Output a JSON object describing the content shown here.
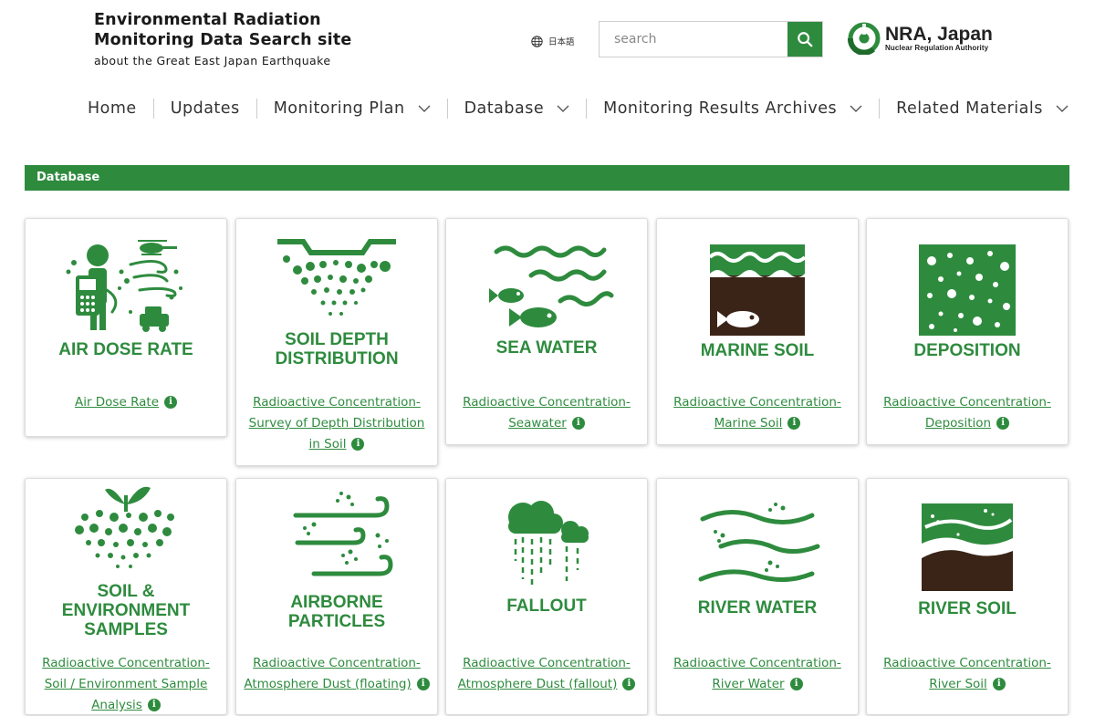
{
  "header": {
    "title_line1": "Environmental Radiation",
    "title_line2": "Monitoring Data Search site",
    "title_line3": "about the Great East Japan Earthquake",
    "language_label": "日本語",
    "search_placeholder": "search",
    "logo_name": "NRA, Japan",
    "logo_sub": "Nuclear Regulation Authority"
  },
  "nav": {
    "items": [
      {
        "label": "Home"
      },
      {
        "label": "Updates"
      },
      {
        "label": "Monitoring Plan"
      },
      {
        "label": "Database"
      },
      {
        "label": "Monitoring Results Archives"
      },
      {
        "label": "Related Materials"
      }
    ]
  },
  "section": {
    "title": "Database"
  },
  "cards": [
    {
      "title_lines": [
        "AIR DOSE RATE"
      ],
      "link": "Air Dose Rate",
      "icon": "air-dose-rate-icon"
    },
    {
      "title_lines": [
        "SOIL DEPTH",
        "DISTRIBUTION"
      ],
      "link": "Radioactive Concentration-Survey of Depth Distribution in Soil",
      "icon": "soil-depth-icon"
    },
    {
      "title_lines": [
        "SEA WATER"
      ],
      "link": "Radioactive Concentration-Seawater",
      "icon": "sea-water-icon"
    },
    {
      "title_lines": [
        "MARINE SOIL"
      ],
      "link": "Radioactive Concentration-Marine Soil",
      "icon": "marine-soil-icon"
    },
    {
      "title_lines": [
        "DEPOSITION"
      ],
      "link": "Radioactive Concentration-Deposition",
      "icon": "deposition-icon"
    },
    {
      "title_lines": [
        "SOIL &",
        "ENVIRONMENT",
        "SAMPLES"
      ],
      "link": "Radioactive Concentration-Soil / Environment Sample Analysis",
      "icon": "soil-environment-icon"
    },
    {
      "title_lines": [
        "AIRBORNE",
        "PARTICLES"
      ],
      "link": "Radioactive Concentration-Atmosphere Dust (floating)",
      "icon": "airborne-particles-icon"
    },
    {
      "title_lines": [
        "FALLOUT"
      ],
      "link": "Radioactive Concentration-Atmosphere Dust (fallout)",
      "icon": "fallout-icon"
    },
    {
      "title_lines": [
        "RIVER WATER"
      ],
      "link": "Radioactive Concentration-River Water",
      "icon": "river-water-icon"
    },
    {
      "title_lines": [
        "RIVER SOIL"
      ],
      "link": "Radioactive Concentration-River Soil",
      "icon": "river-soil-icon"
    }
  ],
  "colors": {
    "brand_green": "#2e8b3e",
    "soil_brown": "#3a2418",
    "text": "#333333"
  }
}
